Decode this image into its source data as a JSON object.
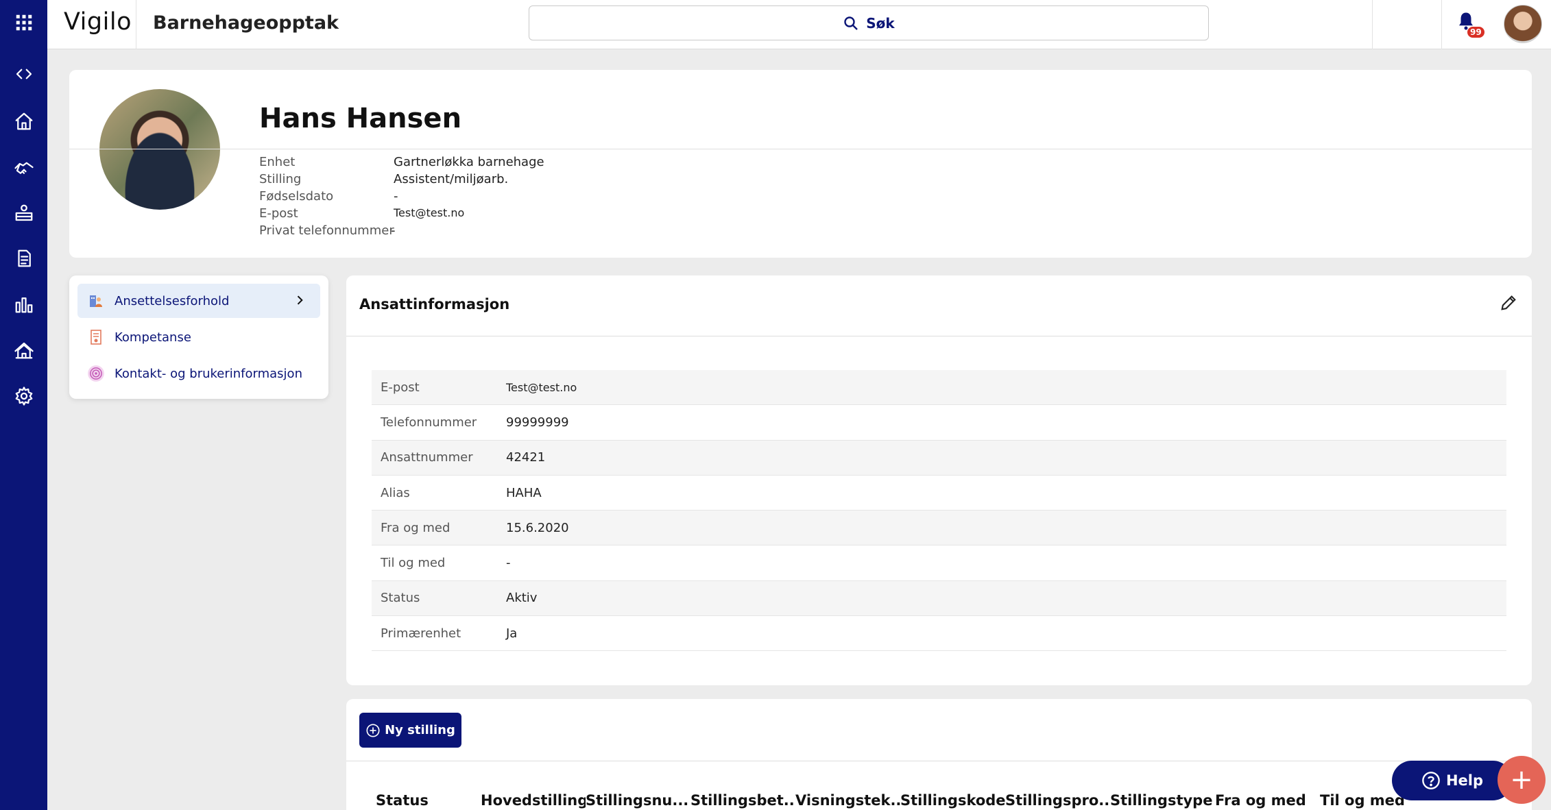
{
  "topbar": {
    "logo": "Vigilo",
    "app_title": "Barnehageopptak",
    "search_label": "Søk",
    "notification_count": "99"
  },
  "rail": {
    "icons": [
      "apps-grid-icon",
      "code-toggle-icon",
      "home-icon",
      "handshake-icon",
      "classroom-icon",
      "document-icon",
      "bar-chart-icon",
      "building-icon",
      "settings-icon"
    ]
  },
  "profile": {
    "name": "Hans Hansen",
    "fields": [
      {
        "label": "Enhet",
        "value": "Gartnerløkka barnehage"
      },
      {
        "label": "Stilling",
        "value": "Assistent/miljøarb."
      },
      {
        "label": "Fødselsdato",
        "value": "-"
      },
      {
        "label": "E-post",
        "value": "Test@test.no"
      },
      {
        "label": "Privat telefonnummer",
        "value": "-"
      }
    ]
  },
  "menu": {
    "items": [
      {
        "label": "Ansettelsesforhold",
        "icon": "employee-icon",
        "active": true
      },
      {
        "label": "Kompetanse",
        "icon": "certificate-icon",
        "active": false
      },
      {
        "label": "Kontakt- og brukerinformasjon",
        "icon": "fingerprint-icon",
        "active": false
      }
    ]
  },
  "employee_info": {
    "title": "Ansattinformasjon",
    "rows": [
      {
        "label": "E-post",
        "value": "Test@test.no"
      },
      {
        "label": "Telefonnummer",
        "value": "99999999"
      },
      {
        "label": "Ansattnummer",
        "value": "42421"
      },
      {
        "label": "Alias",
        "value": "HAHA"
      },
      {
        "label": "Fra og med",
        "value": "15.6.2020"
      },
      {
        "label": "Til og med",
        "value": "-"
      },
      {
        "label": "Status",
        "value": "Aktiv"
      },
      {
        "label": "Primærenhet",
        "value": "Ja"
      }
    ]
  },
  "positions": {
    "new_button": "Ny stilling",
    "columns": [
      "Status",
      "Hovedstilling",
      "Stillingsnu...",
      "Stillingsbet...",
      "Visningstek...",
      "Stillingskode",
      "Stillingspro...",
      "Stillingstype",
      "Fra og med",
      "Til og med"
    ]
  },
  "help_label": "Help",
  "fab_label": "+",
  "colors": {
    "brand": "#0b1577",
    "fab": "#e46557",
    "badge": "#d93025"
  }
}
